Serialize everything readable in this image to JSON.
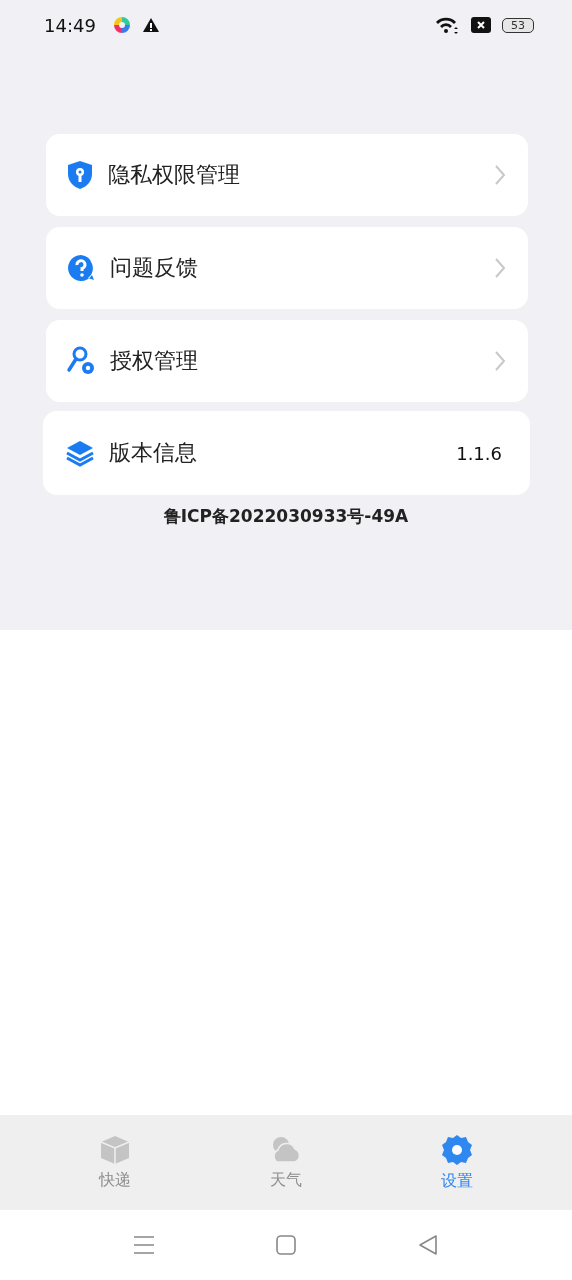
{
  "status_bar": {
    "time": "14:49",
    "battery": "53"
  },
  "menu": [
    {
      "kind": "link",
      "label": "隐私权限管理"
    },
    {
      "kind": "link",
      "label": "问题反馈"
    },
    {
      "kind": "link",
      "label": "授权管理"
    },
    {
      "kind": "info",
      "label": "版本信息",
      "value": "1.1.6"
    }
  ],
  "icp": "鲁ICP备2022030933号-49A",
  "tabs": [
    {
      "label": "快递",
      "selected": false
    },
    {
      "label": "天气",
      "selected": false
    },
    {
      "label": "设置",
      "selected": true
    }
  ]
}
